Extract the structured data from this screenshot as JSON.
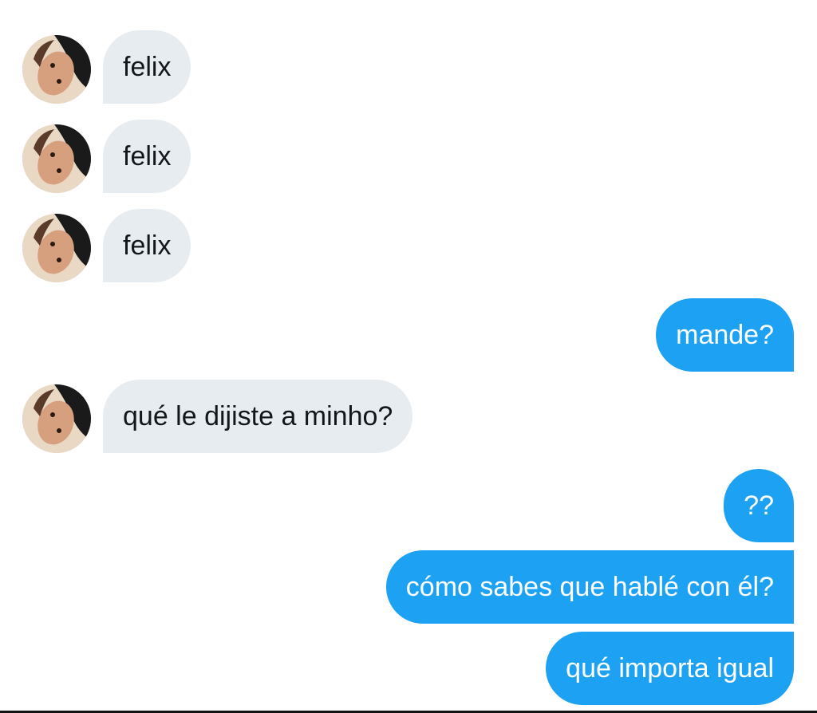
{
  "conversation": {
    "messages": [
      {
        "sender": "them",
        "text": "felix"
      },
      {
        "sender": "them",
        "text": "felix"
      },
      {
        "sender": "them",
        "text": "felix"
      },
      {
        "sender": "me",
        "text": "mande?"
      },
      {
        "sender": "them",
        "text": "qué le dijiste a minho?"
      },
      {
        "sender": "me",
        "text": "??"
      },
      {
        "sender": "me",
        "text": "cómo sabes que hablé con él?"
      },
      {
        "sender": "me",
        "text": "qué importa igual"
      }
    ]
  },
  "colors": {
    "incoming_bubble": "#e6ecf0",
    "incoming_text": "#14171a",
    "outgoing_bubble": "#1da1f2",
    "outgoing_text": "#ffffff"
  },
  "icons": {
    "avatar": "avatar-photo"
  }
}
